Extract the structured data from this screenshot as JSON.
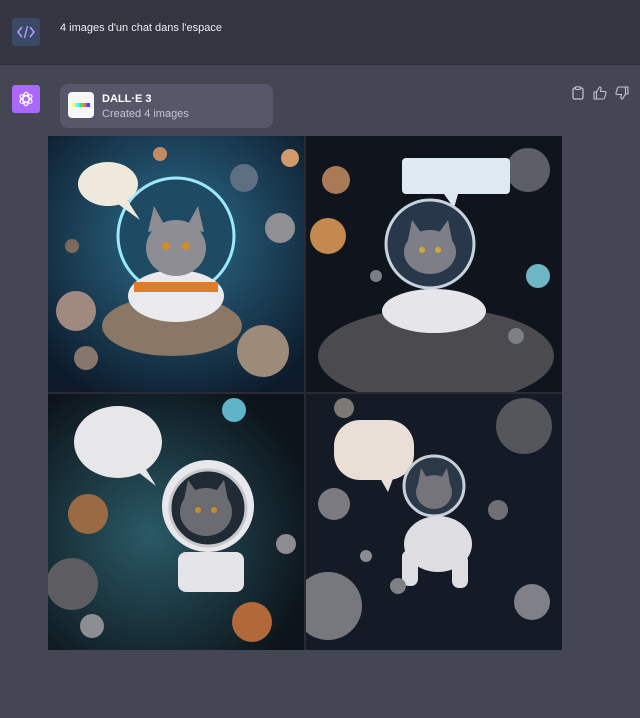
{
  "user": {
    "avatar_icon": "code-icon",
    "prompt": "4 images d'un chat dans l'espace"
  },
  "assistant": {
    "avatar_icon": "openai-logo-icon",
    "tool": {
      "name": "DALL·E 3",
      "status": "Created 4 images"
    },
    "actions": [
      "clipboard-icon",
      "thumbs-up-icon",
      "thumbs-down-icon"
    ],
    "images": [
      {
        "alt": "generated-image-1"
      },
      {
        "alt": "generated-image-2"
      },
      {
        "alt": "generated-image-3"
      },
      {
        "alt": "generated-image-4"
      }
    ]
  },
  "colors": {
    "page_bg": "#444654",
    "user_bg": "#343541",
    "bot_avatar": "#ab68ff",
    "tool_card": "#565869"
  }
}
